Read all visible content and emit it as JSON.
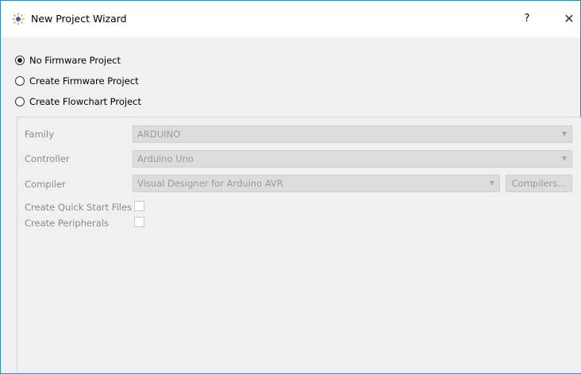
{
  "window": {
    "title": "New Project Wizard",
    "help_label": "?",
    "close_label": "✕",
    "app_icon": "sun-cog-icon"
  },
  "project_type": {
    "options": [
      {
        "label": "No Firmware Project",
        "checked": true
      },
      {
        "label": "Create Firmware Project",
        "checked": false
      },
      {
        "label": "Create Flowchart Project",
        "checked": false
      }
    ]
  },
  "form": {
    "family_label": "Family",
    "family_value": "ARDUINO",
    "controller_label": "Controller",
    "controller_value": "Arduino Uno",
    "compiler_label": "Compiler",
    "compiler_value": "Visual Designer for Arduino AVR",
    "compilers_button": "Compilers...",
    "quick_start_label": "Create Quick Start Files",
    "peripherals_label": "Create Peripherals"
  },
  "colors": {
    "accent_border": "#2a8bc8",
    "disabled_text": "#9a9a9a",
    "panel_bg": "#f0f0f0"
  }
}
